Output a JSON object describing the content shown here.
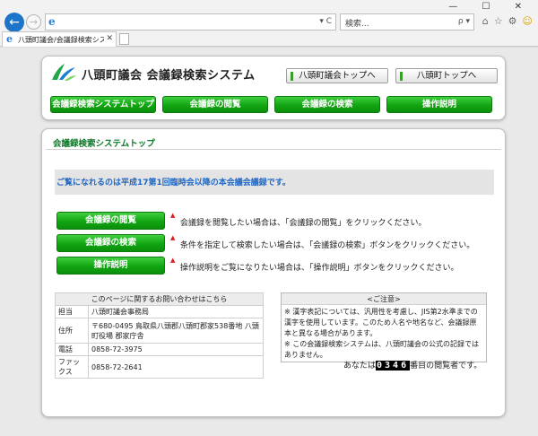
{
  "browser": {
    "address_value": "",
    "address_controls": "▾ C",
    "search_placeholder": "検索...",
    "search_controls": "ρ ▾",
    "tab_title": "八頭町議会/会議録検索シス...",
    "window_buttons": "— ☐ ✕",
    "ie_glyph": "e"
  },
  "header": {
    "site_title": "八頭町議会 会議録検索システム",
    "top_links": [
      "八頭町議会トップへ",
      "八頭町トップへ"
    ],
    "nav": [
      "会議録検索システムトップ",
      "会議録の閲覧",
      "会議録の検索",
      "操作説明"
    ]
  },
  "content": {
    "section_title": "会議録検索システムトップ",
    "notice": "ご覧になれるのは平成17第1回臨時会以降の本会議会議録です。",
    "actions": [
      {
        "label": "会議録の閲覧",
        "desc": "会議録を閲覧したい場合は、「会議録の閲覧」をクリックください。"
      },
      {
        "label": "会議録の検索",
        "desc": "条件を指定して検索したい場合は、「会議録の検索」ボタンをクリックください。"
      },
      {
        "label": "操作説明",
        "desc": "操作説明をご覧になりたい場合は、「操作説明」ボタンをクリックください。"
      }
    ],
    "arrow_glyph": "▲"
  },
  "contact": {
    "heading": "このページに関するお問い合わせはこちら",
    "rows": [
      {
        "label": "担当",
        "value": "八頭町議会事務局"
      },
      {
        "label": "住所",
        "value": "〒680-0495 鳥取県八頭郡八頭町郡家538番地 八頭町役場 郡家庁舎"
      },
      {
        "label": "電話",
        "value": "0858-72-3975"
      },
      {
        "label": "ファックス",
        "value": "0858-72-2641"
      }
    ]
  },
  "caution": {
    "heading": "<ご注意>",
    "lines": [
      "※ 漢字表記については、汎用性を考慮し、JIS第2水準までの漢字を使用しています。このため人名や地名など、会議録原本と異なる場合があります。",
      "※ この会議録検索システムは、八頭町議会の公式の記録ではありません。"
    ]
  },
  "counter": {
    "prefix": "あなたは",
    "value": "0346",
    "suffix": "番目の閲覧者です。"
  }
}
